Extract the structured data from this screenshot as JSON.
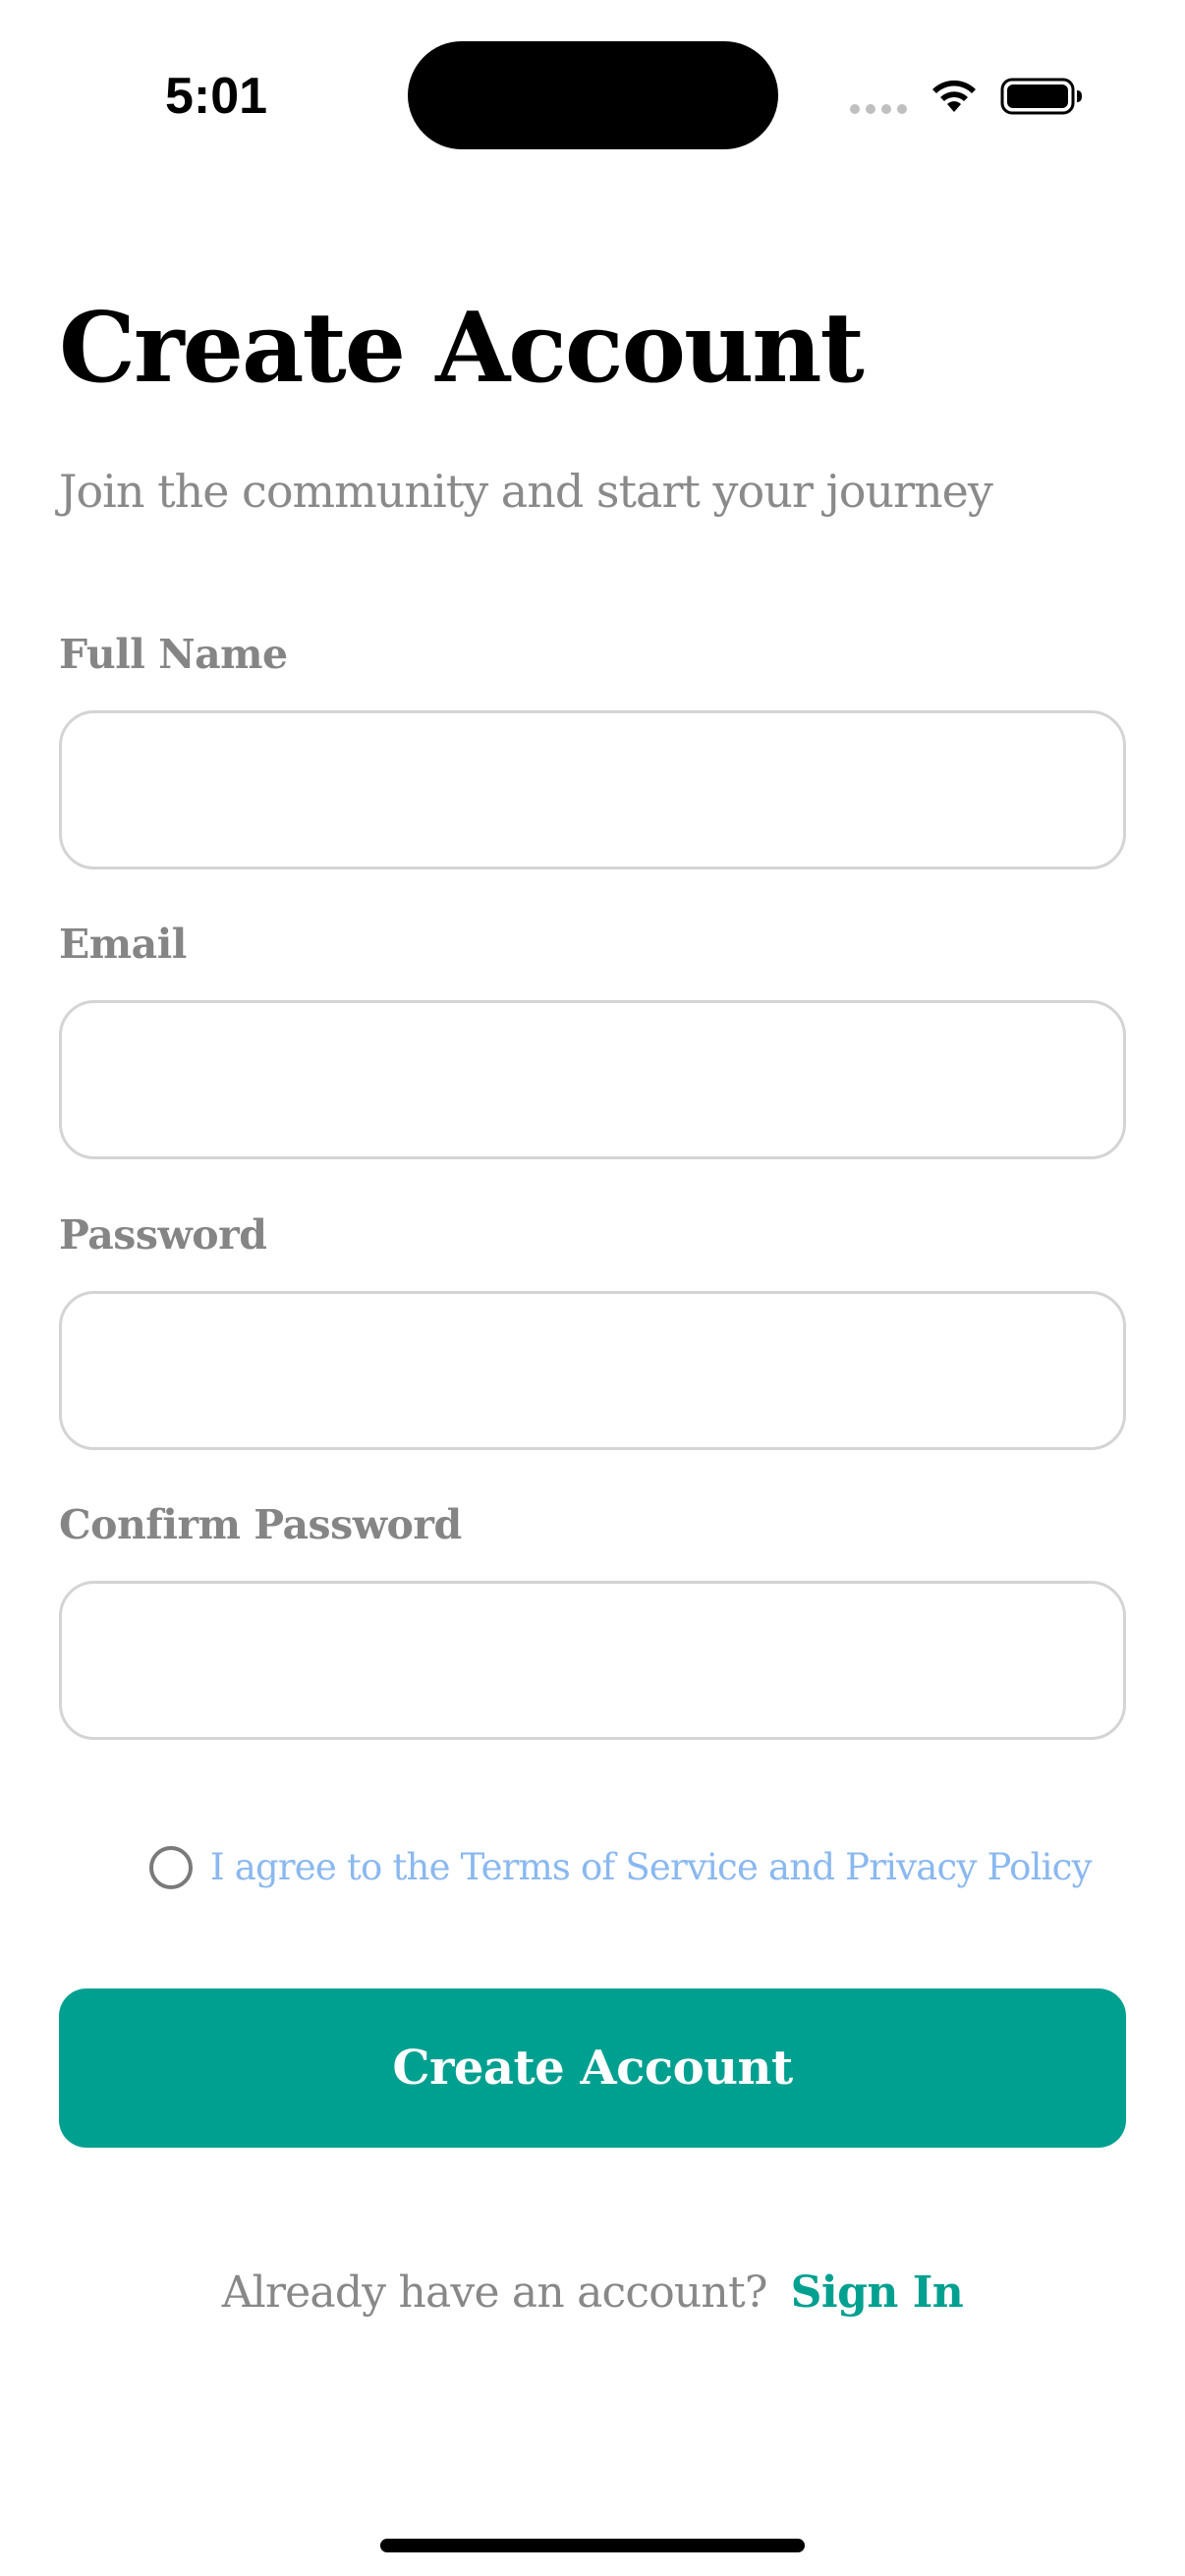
{
  "status_bar": {
    "time": "5:01",
    "icons": [
      "signal-dots-icon",
      "wifi-icon",
      "battery-icon"
    ]
  },
  "header": {
    "title": "Create Account",
    "subtitle": "Join the community and start your journey"
  },
  "form": {
    "full_name": {
      "label": "Full Name",
      "value": ""
    },
    "email": {
      "label": "Email",
      "value": ""
    },
    "password": {
      "label": "Password",
      "value": ""
    },
    "confirm_password": {
      "label": "Confirm Password",
      "value": ""
    }
  },
  "terms": {
    "checked": false,
    "text": "I agree to the Terms of Service and Privacy Policy"
  },
  "primary_button": {
    "label": "Create Account"
  },
  "signin": {
    "prompt": "Already have an account?",
    "link": "Sign In"
  },
  "colors": {
    "accent": "#00a090",
    "label_gray": "#858585",
    "input_border": "#d4d4d4",
    "terms_link": "#8ab8f0"
  }
}
